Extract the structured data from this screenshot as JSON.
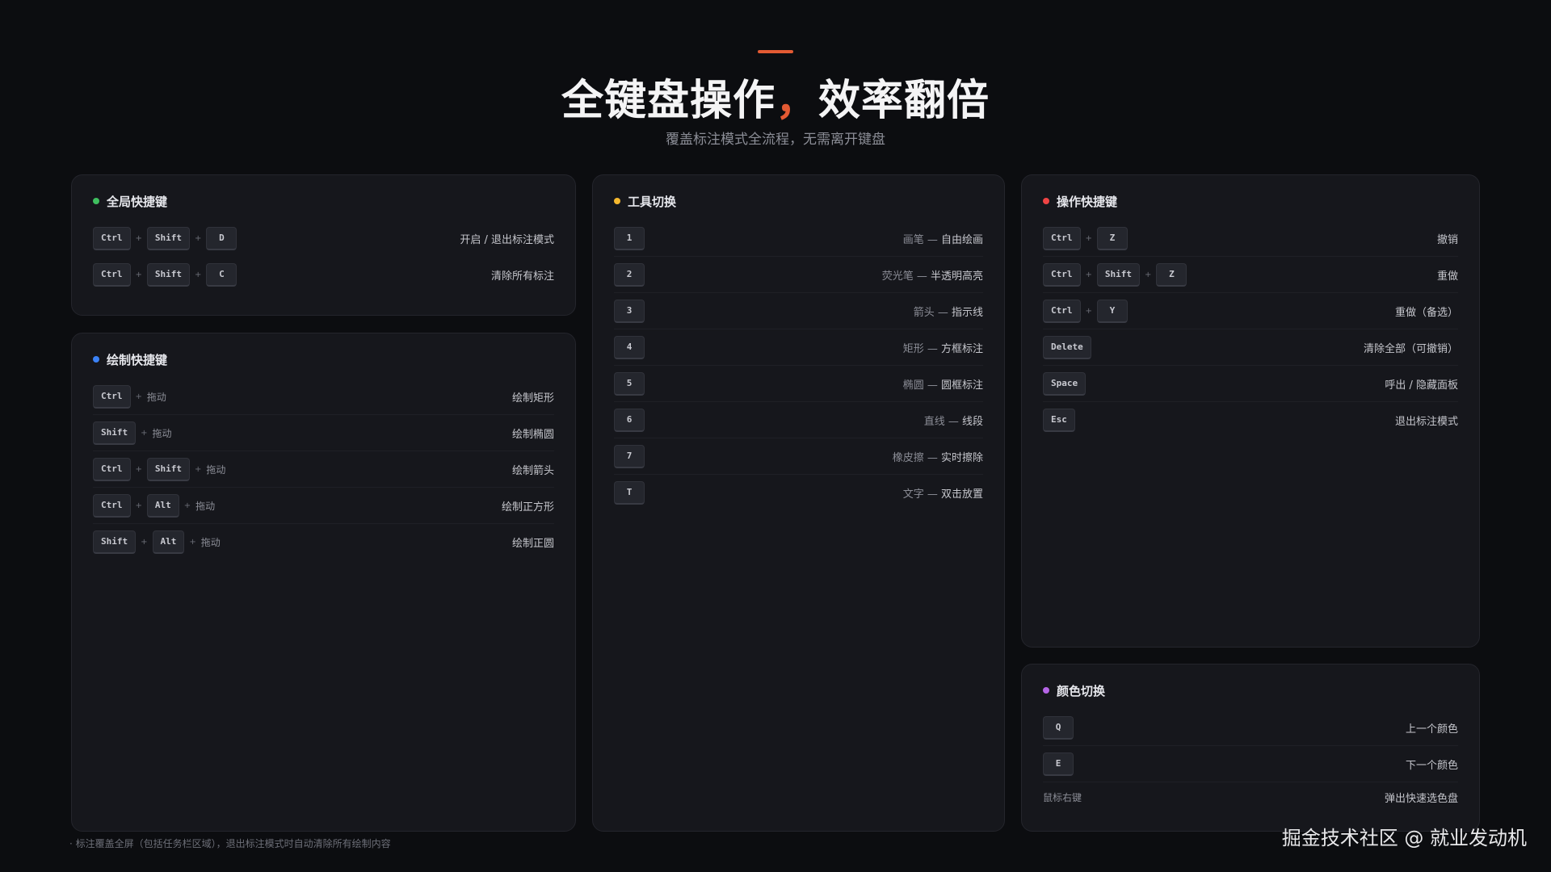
{
  "header": {
    "title_part1": "全键盘操作",
    "title_comma": "，",
    "title_part2": "效率翻倍",
    "subtitle": "覆盖标注模式全流程，无需离开键盘"
  },
  "colors": {
    "accent": "#e35a33",
    "green": "#3fbf5f",
    "blue": "#3b82f6",
    "yellow": "#f5b82e",
    "red": "#ef4444",
    "purple": "#b565e6"
  },
  "global": {
    "title": "全局快捷键",
    "rows": [
      {
        "k1": "Ctrl",
        "k2": "Shift",
        "k3": "D",
        "desc": "开启 / 退出标注模式"
      },
      {
        "k1": "Ctrl",
        "k2": "Shift",
        "k3": "C",
        "desc": "清除所有标注"
      }
    ]
  },
  "draw": {
    "title": "绘制快捷键",
    "drag": "拖动",
    "rows": [
      {
        "k1": "Ctrl",
        "desc": "绘制矩形"
      },
      {
        "k1": "Shift",
        "desc": "绘制椭圆"
      },
      {
        "k1": "Ctrl",
        "k2": "Shift",
        "desc": "绘制箭头"
      },
      {
        "k1": "Ctrl",
        "k2": "Alt",
        "desc": "绘制正方形"
      },
      {
        "k1": "Shift",
        "k2": "Alt",
        "desc": "绘制正圆"
      }
    ]
  },
  "tools": {
    "title": "工具切换",
    "rows": [
      {
        "key": "1",
        "tool": "画笔",
        "sep": "—",
        "desc": "自由绘画"
      },
      {
        "key": "2",
        "tool": "荧光笔",
        "sep": "—",
        "desc": "半透明高亮"
      },
      {
        "key": "3",
        "tool": "箭头",
        "sep": "—",
        "desc": "指示线"
      },
      {
        "key": "4",
        "tool": "矩形",
        "sep": "—",
        "desc": "方框标注"
      },
      {
        "key": "5",
        "tool": "椭圆",
        "sep": "—",
        "desc": "圆框标注"
      },
      {
        "key": "6",
        "tool": "直线",
        "sep": "—",
        "desc": "线段"
      },
      {
        "key": "7",
        "tool": "橡皮擦",
        "sep": "—",
        "desc": "实时擦除"
      },
      {
        "key": "T",
        "tool": "文字",
        "sep": "—",
        "desc": "双击放置"
      }
    ]
  },
  "ops": {
    "title": "操作快捷键",
    "rows": [
      {
        "k1": "Ctrl",
        "k2": "Z",
        "desc": "撤销"
      },
      {
        "k1": "Ctrl",
        "k2": "Shift",
        "k3": "Z",
        "desc": "重做"
      },
      {
        "k1": "Ctrl",
        "k2": "Y",
        "desc": "重做（备选）"
      },
      {
        "k1": "Delete",
        "desc": "清除全部（可撤销）"
      },
      {
        "k1": "Space",
        "desc": "呼出 / 隐藏面板"
      },
      {
        "k1": "Esc",
        "desc": "退出标注模式"
      }
    ]
  },
  "color": {
    "title": "颜色切换",
    "rows": [
      {
        "key": "Q",
        "desc": "上一个颜色"
      },
      {
        "key": "E",
        "desc": "下一个颜色"
      }
    ],
    "mouse_key": "鼠标右键",
    "mouse_desc": "弹出快速选色盘"
  },
  "footnote": "· 标注覆盖全屏（包括任务栏区域），退出标注模式时自动清除所有绘制内容",
  "watermark": "掘金技术社区 @ 就业发动机",
  "plus": "+"
}
